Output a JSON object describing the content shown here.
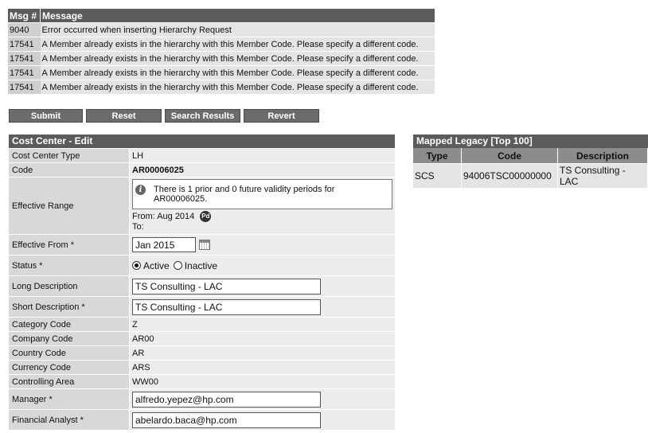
{
  "messages": {
    "headers": [
      "Msg #",
      "Message"
    ],
    "rows": [
      {
        "num": "9040",
        "text": "Error occurred when inserting Hierarchy Request"
      },
      {
        "num": "17541",
        "text": "A Member already exists in the hierarchy with this Member Code. Please specify a different code."
      },
      {
        "num": "17541",
        "text": "A Member already exists in the hierarchy with this Member Code. Please specify a different code."
      },
      {
        "num": "17541",
        "text": "A Member already exists in the hierarchy with this Member Code. Please specify a different code."
      },
      {
        "num": "17541",
        "text": "A Member already exists in the hierarchy with this Member Code. Please specify a different code."
      }
    ]
  },
  "buttons": {
    "submit": "Submit",
    "reset": "Reset",
    "search_results": "Search Results",
    "revert": "Revert"
  },
  "form": {
    "title": "Cost Center - Edit",
    "cost_center_type": {
      "label": "Cost Center Type",
      "value": "LH"
    },
    "code": {
      "label": "Code",
      "value": "AR00006025"
    },
    "effective_range": {
      "label": "Effective Range",
      "info": "There is 1 prior and 0 future validity periods for AR00006025.",
      "from_label": "From:",
      "from_value": "Aug 2014",
      "to_label": "To:",
      "pd_icon_text": "Pd"
    },
    "effective_from": {
      "label": "Effective From *",
      "value": "Jan 2015"
    },
    "status": {
      "label": "Status *",
      "active": "Active",
      "inactive": "Inactive",
      "selected": "Active"
    },
    "long_description": {
      "label": "Long Description",
      "value": "TS Consulting - LAC"
    },
    "short_description": {
      "label": "Short Description *",
      "value": "TS Consulting - LAC"
    },
    "category_code": {
      "label": "Category Code",
      "value": "Z"
    },
    "company_code": {
      "label": "Company Code",
      "value": "AR00"
    },
    "country_code": {
      "label": "Country Code",
      "value": "AR"
    },
    "currency_code": {
      "label": "Currency Code",
      "value": "ARS"
    },
    "controlling_area": {
      "label": "Controlling Area",
      "value": "WW00"
    },
    "manager": {
      "label": "Manager *",
      "value": "alfredo.yepez@hp.com"
    },
    "financial_analyst": {
      "label": "Financial Analyst *",
      "value": "abelardo.baca@hp.com"
    }
  },
  "legacy": {
    "title": "Mapped Legacy [Top 100]",
    "headers": [
      "Type",
      "Code",
      "Description"
    ],
    "rows": [
      {
        "type": "SCS",
        "code": "94006TSC00000000",
        "description": "TS Consulting - LAC"
      }
    ]
  },
  "icons": {
    "info": "info-icon",
    "pd": "period-detail-icon",
    "calendar": "calendar-icon"
  }
}
